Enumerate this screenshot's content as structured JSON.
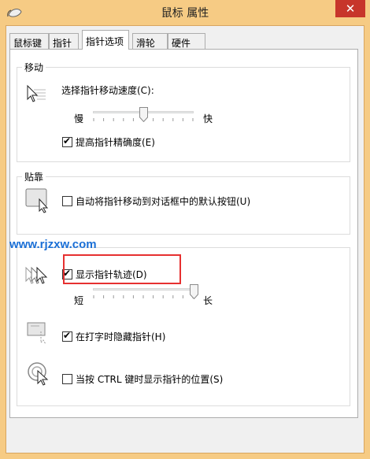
{
  "window": {
    "title": "鼠标 属性",
    "close_label": "✕"
  },
  "tabs": [
    {
      "label": "鼠标键",
      "active": false
    },
    {
      "label": "指针",
      "active": false
    },
    {
      "label": "指针选项",
      "active": true
    },
    {
      "label": "滑轮",
      "active": false
    },
    {
      "label": "硬件",
      "active": false
    }
  ],
  "motion": {
    "group_title": "移动",
    "speed_label": "选择指针移动速度(C):",
    "slow_label": "慢",
    "fast_label": "快",
    "speed_level": 0.5,
    "precision_label": "提高指针精确度(E)",
    "precision_checked": true
  },
  "snap": {
    "group_title": "贴靠",
    "snap_label": "自动将指针移动到对话框中的默认按钮(U)",
    "snap_checked": false
  },
  "visibility": {
    "trails_label": "显示指针轨迹(D)",
    "trails_checked": true,
    "short_label": "短",
    "long_label": "长",
    "trails_level": 1.0,
    "hide_label": "在打字时隐藏指针(H)",
    "hide_checked": true,
    "ctrl_label": "当按 CTRL 键时显示指针的位置(S)",
    "ctrl_checked": false
  },
  "watermark": "www.rjzxw.com",
  "colors": {
    "titlebar": "#f6cb84",
    "close": "#c7352b",
    "highlight": "#e63030",
    "watermark": "#1a6fd6"
  }
}
